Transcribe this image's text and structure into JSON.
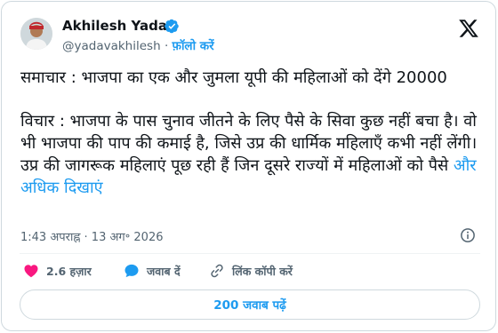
{
  "author": {
    "display_name": "Akhilesh Yadav",
    "handle": "@yadavakhilesh",
    "separator": "·",
    "follow_label": "फ़ॉलो करें",
    "verified": true
  },
  "tweet": {
    "paragraph1": "समाचार : भाजपा का एक और जुमला यूपी की महिलाओं को देंगे 20000",
    "paragraph2": "विचार : भाजपा के पास चुनाव जीतने के लिए पैसे के सिवा कुछ नहीं बचा है। वो भी भाजपा की पाप की कमाई है, जिसे उप्र की धार्मिक महिलाएँ कभी नहीं लेंगी। उप्र की जागरूक महिलाएं पूछ रही हैं जिन दूसरे राज्यों में महिलाओं को पैसे",
    "show_more": "और अधिक दिखाएं"
  },
  "meta": {
    "timestamp": "1:43 अपराह्न · 13 अग॰ 2026"
  },
  "actions": {
    "likes": "2.6 हज़ार",
    "reply": "जवाब दें",
    "copy_link": "लिंक कॉपी करें"
  },
  "replies_button": "200 जवाब पढ़ें",
  "colors": {
    "accent": "#1d9bf0",
    "like": "#f91880",
    "text": "#0f1419",
    "muted": "#536471",
    "border": "#cfd9de"
  },
  "icons": {
    "verified": "verified-badge-icon",
    "logo": "x-logo-icon",
    "info": "info-icon",
    "like": "heart-icon",
    "reply": "reply-bubble-icon",
    "copy": "link-icon"
  }
}
